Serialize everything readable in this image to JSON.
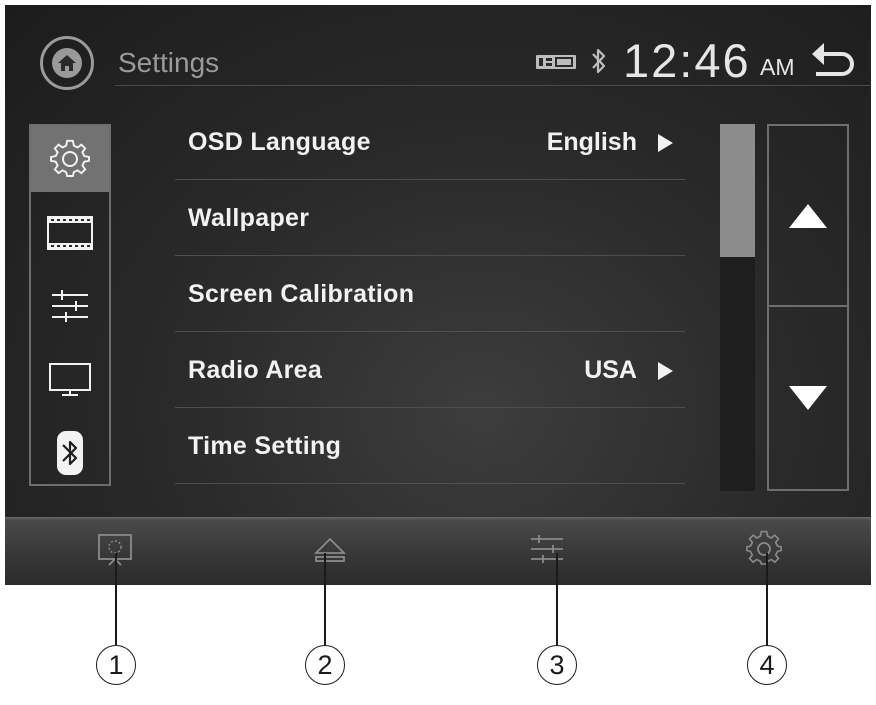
{
  "header": {
    "title": "Settings",
    "time": "12:46",
    "ampm": "AM"
  },
  "sidebar": {
    "items": [
      {
        "icon": "gear-icon",
        "active": true
      },
      {
        "icon": "film-icon",
        "active": false
      },
      {
        "icon": "sliders-icon",
        "active": false
      },
      {
        "icon": "monitor-icon",
        "active": false
      },
      {
        "icon": "bluetooth-icon",
        "active": false
      }
    ]
  },
  "menu": {
    "items": [
      {
        "label": "OSD Language",
        "value": "English"
      },
      {
        "label": "Wallpaper",
        "value": ""
      },
      {
        "label": "Screen Calibration",
        "value": ""
      },
      {
        "label": "Radio Area",
        "value": "USA"
      },
      {
        "label": "Time Setting",
        "value": ""
      }
    ]
  },
  "bottom_bar": {
    "buttons": [
      "display-icon",
      "eject-icon",
      "equalizer-icon",
      "settings-icon"
    ]
  },
  "callouts": [
    "1",
    "2",
    "3",
    "4"
  ],
  "colors": {
    "background": "#2a2a2a",
    "active_tab": "#727272",
    "text": "#f2f2f2",
    "title_text": "#9a9a9a"
  }
}
